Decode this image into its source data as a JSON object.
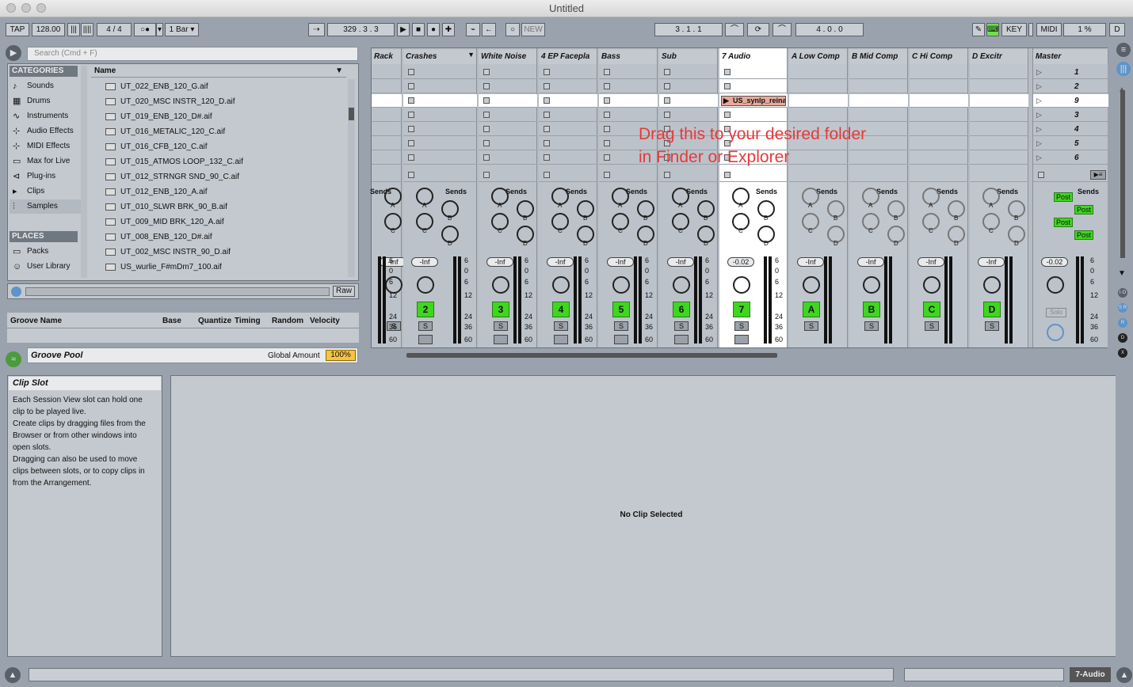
{
  "window": {
    "title": "Untitled"
  },
  "transport": {
    "tap": "TAP",
    "tempo": "128.00",
    "signature_num": "4",
    "signature_sep": "/",
    "signature_den": "4",
    "quantize": "1 Bar",
    "position": "329 .  3 .  3",
    "new_label": "NEW",
    "loop_start": "3 .  1 .  1",
    "loop_length": "4 .  0 .  0",
    "key_label": "KEY",
    "midi_label": "MIDI",
    "cpu": "1 %",
    "d_label": "D"
  },
  "browser": {
    "search_placeholder": "Search (Cmd + F)",
    "categories_title": "CATEGORIES",
    "categories": [
      {
        "label": "Sounds",
        "icon": "note-icon"
      },
      {
        "label": "Drums",
        "icon": "grid-icon"
      },
      {
        "label": "Instruments",
        "icon": "wave-icon"
      },
      {
        "label": "Audio Effects",
        "icon": "fx-icon"
      },
      {
        "label": "MIDI Effects",
        "icon": "midi-fx-icon"
      },
      {
        "label": "Max for Live",
        "icon": "max-icon"
      },
      {
        "label": "Plug-ins",
        "icon": "plugin-icon"
      },
      {
        "label": "Clips",
        "icon": "clip-icon"
      },
      {
        "label": "Samples",
        "icon": "sample-icon"
      }
    ],
    "places_title": "PLACES",
    "places": [
      {
        "label": "Packs",
        "icon": "box-icon"
      },
      {
        "label": "User Library",
        "icon": "user-icon"
      }
    ],
    "name_header": "Name",
    "files": [
      "UT_022_ENB_120_G.aif",
      "UT_020_MSC INSTR_120_D.aif",
      "UT_019_ENB_120_D#.aif",
      "UT_016_METALIC_120_C.aif",
      "UT_016_CFB_120_C.aif",
      "UT_015_ATMOS LOOP_132_C.aif",
      "UT_012_STRNGR SND_90_C.aif",
      "UT_012_ENB_120_A.aif",
      "UT_010_SLWR BRK_90_B.aif",
      "UT_009_MID BRK_120_A.aif",
      "UT_008_ENB_120_D#.aif",
      "UT_002_MSC INSTR_90_D.aif",
      "US_wurlie_F#mDm7_100.aif"
    ],
    "raw_label": "Raw"
  },
  "groove": {
    "cols": [
      "Groove Name",
      "Base",
      "Quantize",
      "Timing",
      "Random",
      "Velocity"
    ],
    "pool_label": "Groove Pool",
    "global_amount_label": "Global Amount",
    "global_amount_value": "100%"
  },
  "help": {
    "title": "Clip Slot",
    "lines": [
      "Each Session View slot can hold one",
      "clip to be played live.",
      "Create clips by dragging files from the",
      "Browser or from other windows into",
      "open slots.",
      "Dragging can also be used to move",
      "clips between slots, or to copy clips in",
      "from the Arrangement."
    ]
  },
  "session": {
    "tracks": [
      {
        "name": "Rack",
        "num": ""
      },
      {
        "name": "Crashes",
        "num": "2"
      },
      {
        "name": "White Noise",
        "num": "3"
      },
      {
        "name": "4 EP Facepla",
        "num": "4"
      },
      {
        "name": "Bass",
        "num": "5"
      },
      {
        "name": "Sub",
        "num": "6"
      },
      {
        "name": "7 Audio",
        "num": "7"
      },
      {
        "name": "A Low Comp",
        "num": "A"
      },
      {
        "name": "B Mid Comp",
        "num": "B"
      },
      {
        "name": "C Hi Comp",
        "num": "C"
      },
      {
        "name": "D Excitr",
        "num": "D"
      }
    ],
    "master_name": "Master",
    "scenes": [
      "1",
      "2",
      "9",
      "3",
      "4",
      "5",
      "6"
    ],
    "clip_name": "US_synlp_reina",
    "sends_label": "Sends",
    "vol_inf": "-Inf",
    "vol_active": "-0.02",
    "solo_label": "S",
    "post_label": "Post",
    "solo_word": "Solo",
    "meter_scale": [
      "6",
      "0",
      "6",
      "12",
      "24",
      "36",
      "60"
    ],
    "send_letters": [
      "A",
      "B",
      "C",
      "D"
    ]
  },
  "overlay": {
    "line1": "Drag this to your desired folder",
    "line2": "in Finder or Explorer"
  },
  "detail": {
    "empty": "No Clip Selected"
  },
  "status": {
    "track_label": "7-Audio"
  },
  "colors": {
    "accent_green": "#3fd620",
    "clip_color": "#e8a89a",
    "overlay_red": "#e53a3a"
  }
}
